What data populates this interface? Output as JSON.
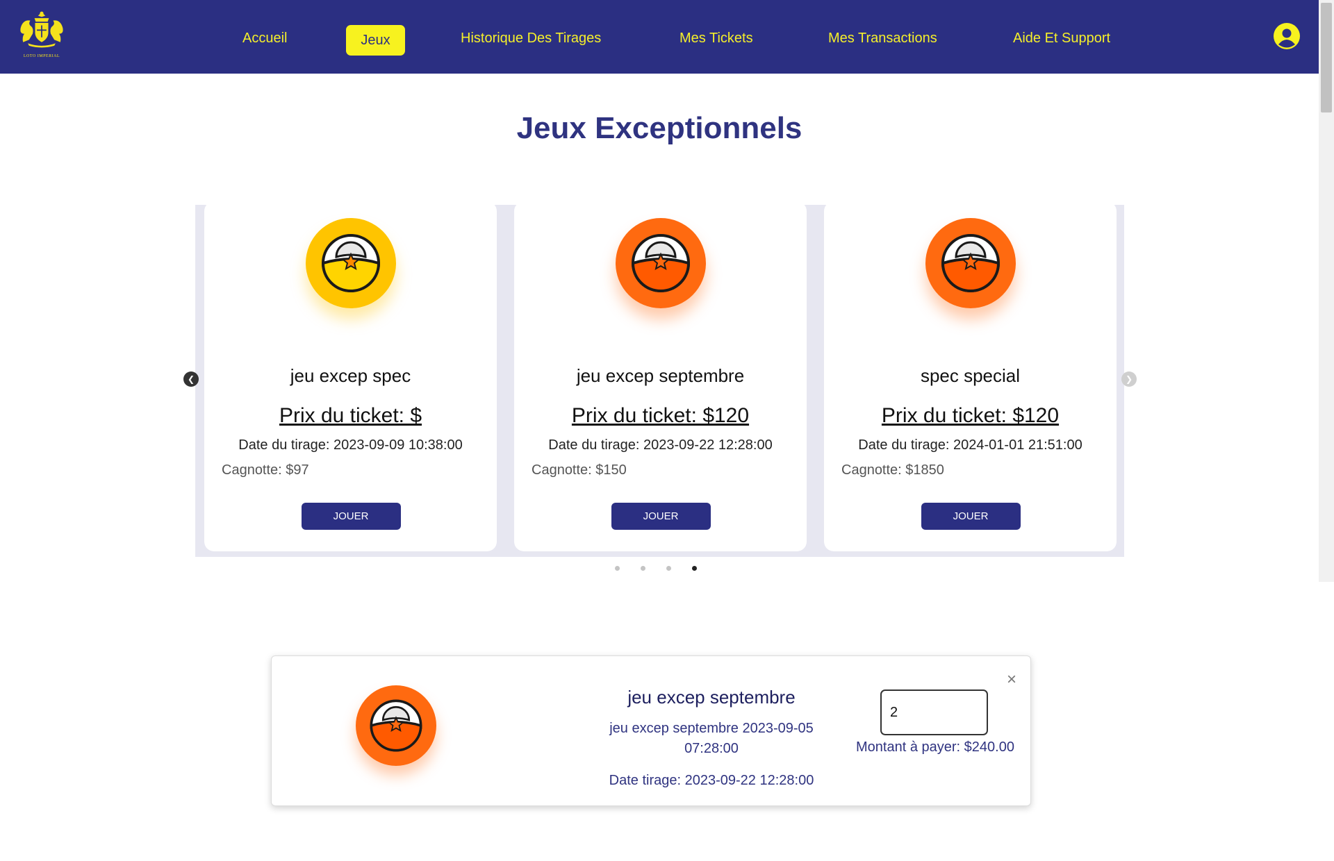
{
  "header": {
    "logo_text": "LOTO IMPERIAL",
    "nav": [
      {
        "label": "Accueil"
      },
      {
        "label": "Jeux",
        "active": true
      },
      {
        "label": "Historique Des Tirages"
      },
      {
        "label": "Mes Tickets"
      },
      {
        "label": "Mes Transactions"
      },
      {
        "label": "Aide Et Support"
      }
    ],
    "user_icon": "user-circle-icon"
  },
  "page": {
    "title": "Jeux Exceptionnels"
  },
  "carousel": {
    "cards": [
      {
        "name": "jeu excep spec",
        "price": "Prix du ticket: $",
        "date": "Date du tirage: 2023-09-09 10:38:00",
        "pot": "Cagnotte: $97",
        "button": "JOUER",
        "ball_color": "yellow"
      },
      {
        "name": "jeu excep septembre",
        "price": "Prix du ticket: $120",
        "date": "Date du tirage: 2023-09-22 12:28:00",
        "pot": "Cagnotte: $150",
        "button": "JOUER",
        "ball_color": "orange"
      },
      {
        "name": "spec special",
        "price": "Prix du ticket: $120",
        "date": "Date du tirage: 2024-01-01 21:51:00",
        "pot": "Cagnotte: $1850",
        "button": "JOUER",
        "ball_color": "orange"
      }
    ],
    "prev_icon": "chevron-left-icon",
    "next_icon": "chevron-right-icon",
    "dots": 4,
    "active_dot": 4
  },
  "panel": {
    "name": "jeu excep septembre",
    "subtitle": "jeu excep septembre 2023-09-05 07:28:00",
    "draw_date": "Date tirage: 2023-09-22 12:28:00",
    "quantity": "2",
    "amount": "Montant à payer: $240.00",
    "close_icon": "close-icon",
    "close_glyph": "×"
  },
  "colors": {
    "brand_navy": "#2b2f82",
    "nav_yellow": "#f5ef2a",
    "ball_yellow": "#ffc400",
    "ball_orange": "#ff6a10"
  }
}
